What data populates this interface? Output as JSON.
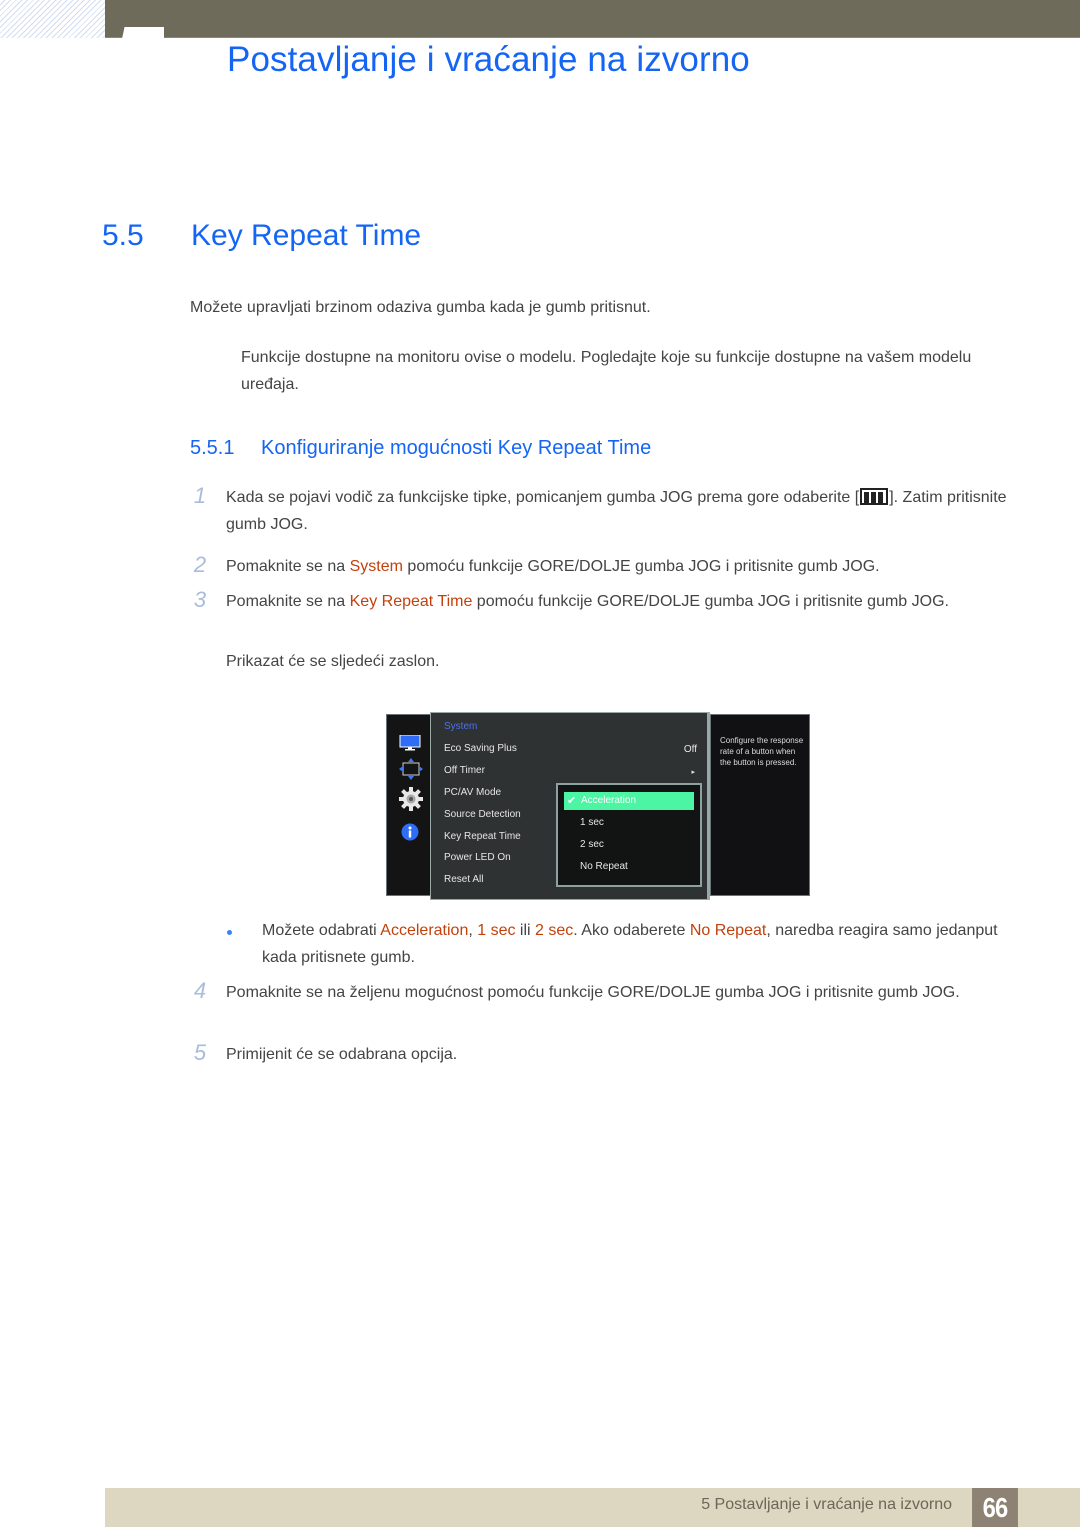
{
  "header": {
    "chapter_title": "Postavljanje i vraćanje na izvorno"
  },
  "section": {
    "number": "5.5",
    "title": "Key Repeat Time",
    "intro": "Možete upravljati brzinom odaziva gumba kada je gumb pritisnut.",
    "note": "Funkcije dostupne na monitoru ovise o modelu. Pogledajte koje su funkcije dostupne na vašem modelu uređaja."
  },
  "subsection": {
    "number": "5.5.1",
    "title": "Konfiguriranje mogućnosti Key Repeat Time"
  },
  "steps": [
    {
      "num": "1",
      "text_before": "Kada se pojavi vodič za funkcijske tipke, pomicanjem gumba JOG prema gore odaberite [",
      "icon": "menu-icon",
      "text_after": "]. Zatim pritisnite gumb JOG."
    },
    {
      "num": "2",
      "text_before": "Pomaknite se na ",
      "highlight": "System",
      "text_after": " pomoću funkcije GORE/DOLJE gumba JOG i pritisnite gumb JOG."
    },
    {
      "num": "3",
      "text_before": "Pomaknite se na ",
      "highlight": "Key Repeat Time",
      "text_after": " pomoću funkcije GORE/DOLJE gumba JOG i pritisnite gumb JOG.",
      "followup": "Prikazat će se sljedeći zaslon."
    },
    {
      "num": "4",
      "text": "Pomaknite se na željenu mogućnost pomoću funkcije GORE/DOLJE gumba JOG i pritisnite gumb JOG."
    },
    {
      "num": "5",
      "text": "Primijenit će se odabrana opcija."
    }
  ],
  "bullet": {
    "t1": "Možete odabrati ",
    "h1": "Acceleration",
    "t2": ", ",
    "h2": "1 sec",
    "t3": " ili ",
    "h3": "2 sec",
    "t4": ". Ako odaberete ",
    "h4": "No Repeat",
    "t5": ", naredba reagira samo jedanput kada pritisnete gumb."
  },
  "osd": {
    "side_icons": [
      "monitor-icon",
      "size-position-icon",
      "gear-icon",
      "info-icon"
    ],
    "category": "System",
    "items": [
      {
        "label": "Eco Saving Plus",
        "value": "Off"
      },
      {
        "label": "Off Timer",
        "value": "▸"
      },
      {
        "label": "PC/AV Mode",
        "value": ""
      },
      {
        "label": "Source Detection",
        "value": ""
      },
      {
        "label": "Key Repeat Time",
        "value": ""
      },
      {
        "label": "Power LED On",
        "value": ""
      },
      {
        "label": "Reset All",
        "value": ""
      }
    ],
    "submenu": {
      "selected": "Acceleration",
      "options": [
        "Acceleration",
        "1 sec",
        "2 sec",
        "No Repeat"
      ]
    },
    "help_text": "Configure the response rate of a button when the button is pressed.",
    "colors": {
      "category": "#4d6ff0",
      "selection": "#4bf5a4"
    }
  },
  "footer": {
    "chapter_label": "5 Postavljanje i vraćanje na izvorno",
    "page_number": "66"
  },
  "colors": {
    "heading_blue": "#1565f5",
    "highlight_orange": "#c2410c",
    "top_bar": "#6e6b5a",
    "footer_bar": "#ddd6c1",
    "page_box": "#8d8274"
  }
}
